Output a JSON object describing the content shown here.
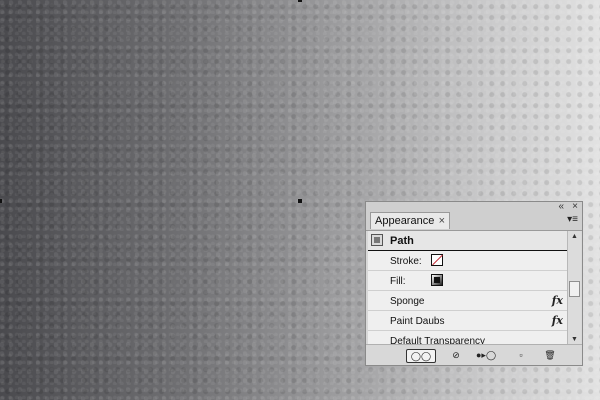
{
  "panel": {
    "tab_label": "Appearance",
    "tab_close_glyph": "×",
    "collapse_glyph": "«",
    "close_glyph": "×",
    "menu_glyph": "▾≡",
    "header": {
      "label": "Path"
    },
    "rows": [
      {
        "label": "Stroke:",
        "kind": "swatch",
        "swatch": "stroke"
      },
      {
        "label": "Fill:",
        "kind": "swatch",
        "swatch": "fill"
      },
      {
        "label": "Sponge",
        "kind": "effect",
        "fx": "fx"
      },
      {
        "label": "Paint Daubs",
        "kind": "effect",
        "fx": "fx"
      },
      {
        "label": "Default Transparency",
        "kind": "text"
      }
    ],
    "scroll": {
      "up": "▲",
      "down": "▼"
    },
    "bottom": {
      "toggle": "◯◯",
      "clear": "⊘",
      "reduce": "●▸◯",
      "duplicate": "▫",
      "trash": "🗑"
    }
  },
  "colors": {
    "stroke_none_slash": "#c0202a",
    "panel_bg": "#d8d8d8",
    "list_bg": "#efefef"
  }
}
